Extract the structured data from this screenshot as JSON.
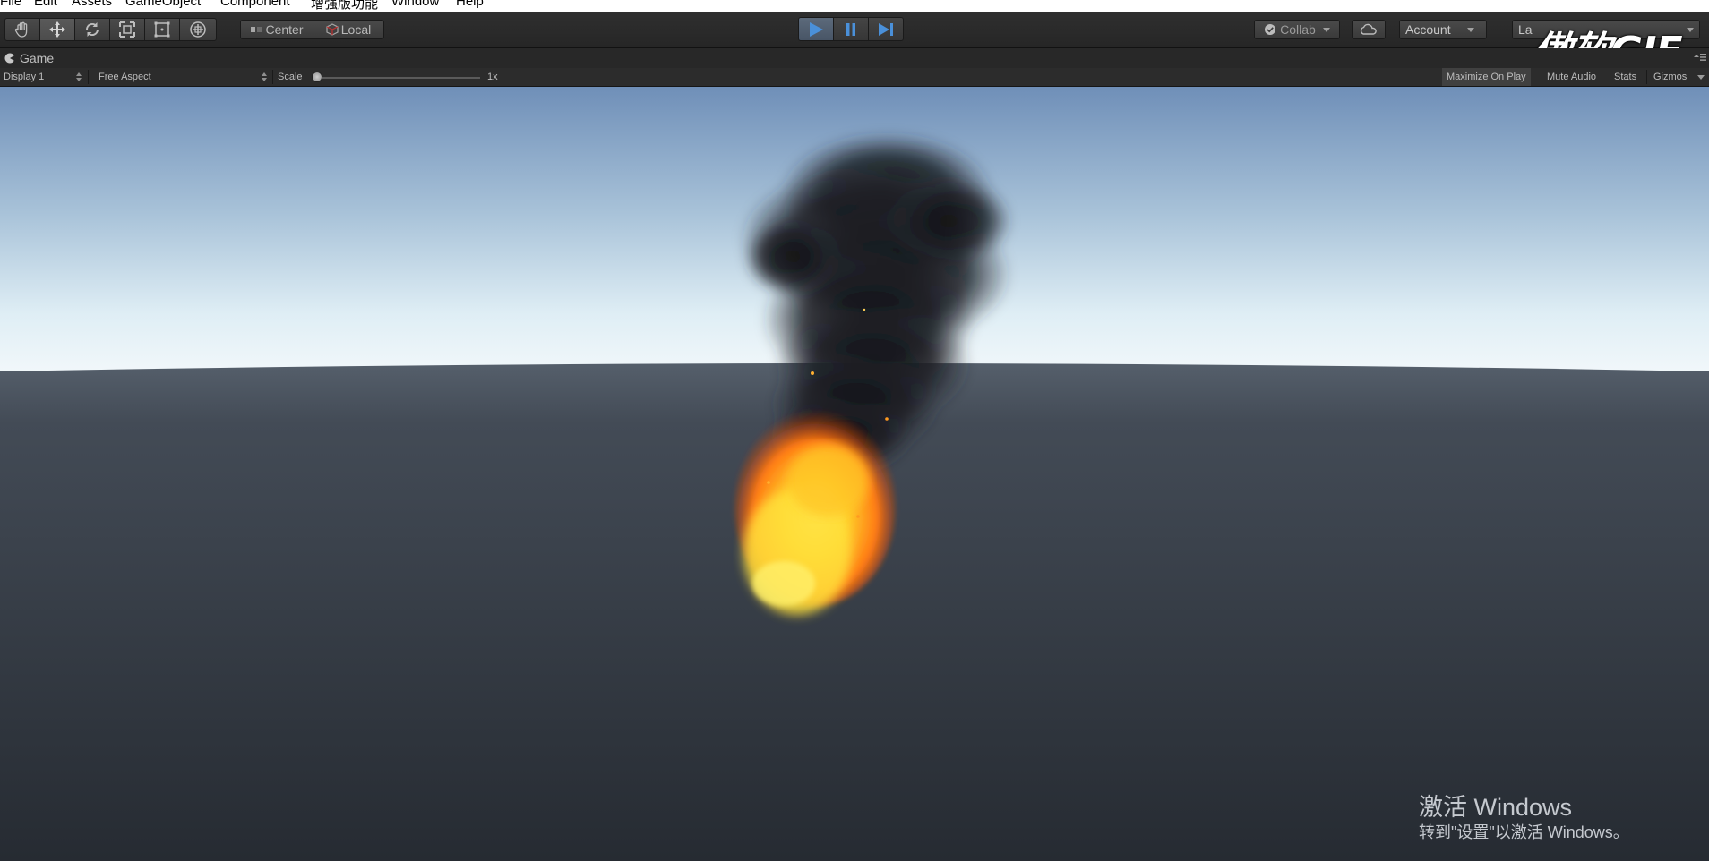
{
  "menu": [
    "File",
    "Edit",
    "Assets",
    "GameObject",
    "Component",
    "增强版功能",
    "Window",
    "Help"
  ],
  "toolbar": {
    "tools": [
      {
        "name": "hand-tool",
        "icon": "hand-icon"
      },
      {
        "name": "move-tool",
        "icon": "move-icon"
      },
      {
        "name": "rotate-tool",
        "icon": "rotate-icon"
      },
      {
        "name": "scale-tool",
        "icon": "scale-icon"
      },
      {
        "name": "rect-tool",
        "icon": "rect-icon"
      },
      {
        "name": "transform-tool",
        "icon": "transform-icon"
      }
    ],
    "active_tool": "move-tool",
    "pivot_label": "Center",
    "space_label": "Local",
    "collab_label": "Collab",
    "account_label": "Account",
    "layers_label": "La",
    "watermark": "傲软GIF",
    "play_active": true
  },
  "game_tab": {
    "title": "Game"
  },
  "controls": {
    "display": "Display 1",
    "aspect": "Free Aspect",
    "scale_label": "Scale",
    "scale_value": "1x",
    "maximize_on_play": "Maximize On Play",
    "mute_audio": "Mute Audio",
    "stats": "Stats",
    "gizmos": "Gizmos"
  },
  "windows_activation": {
    "line1": "激活 Windows",
    "line2": "转到\"设置\"以激活 Windows。"
  },
  "colors": {
    "sky_top": "#6f8fb8",
    "sky_horizon": "#f1f7fa",
    "ground": "#2d333c",
    "fire_core": "#ffe03a",
    "fire_outer": "#ff6a10",
    "smoke": "#151518",
    "play_accent": "#4a90d9"
  }
}
